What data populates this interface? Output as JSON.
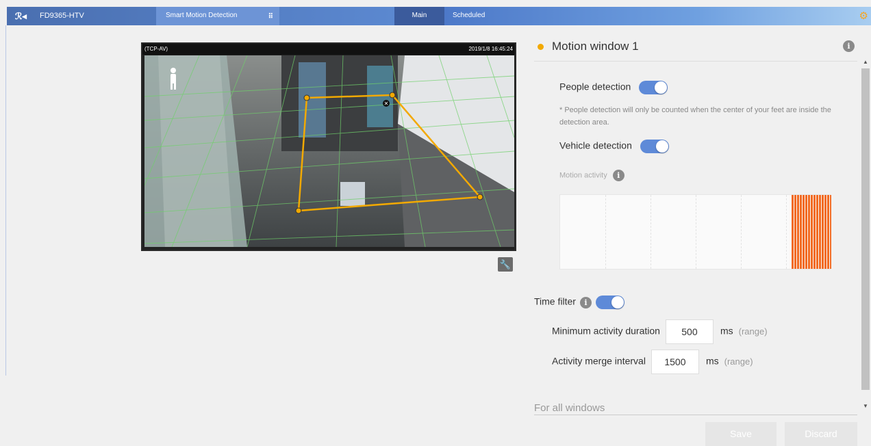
{
  "topbar": {
    "logo": "ℛ◂",
    "device": "FD9365-HTV",
    "app": "Smart Motion Detection",
    "app_icon": "grid-icon",
    "tabs": [
      {
        "label": "Main",
        "active": true
      },
      {
        "label": "Scheduled",
        "active": false
      }
    ],
    "settings_icon": "gear-icon"
  },
  "video": {
    "stream": "(TCP-AV)",
    "timestamp": "2019/1/8 16:45:24"
  },
  "panel": {
    "title": "Motion window 1",
    "title_dot_color": "#f2a900",
    "people_label": "People detection",
    "people_on": true,
    "note": "* People detection will only be counted when the center of your feet are inside the detection area.",
    "vehicle_label": "Vehicle detection",
    "vehicle_on": true,
    "activity_label": "Motion activity",
    "activity_bar_color": "#f26a21",
    "time_filter_label": "Time filter",
    "time_filter_on": true,
    "min_duration_label": "Minimum activity duration",
    "min_duration_value": "500",
    "merge_label": "Activity merge interval",
    "merge_value": "1500",
    "unit": "ms",
    "range": "(range)",
    "for_all": "For all windows"
  },
  "buttons": {
    "save": "Save",
    "discard": "Discard"
  },
  "accent": "#5e8ad8"
}
